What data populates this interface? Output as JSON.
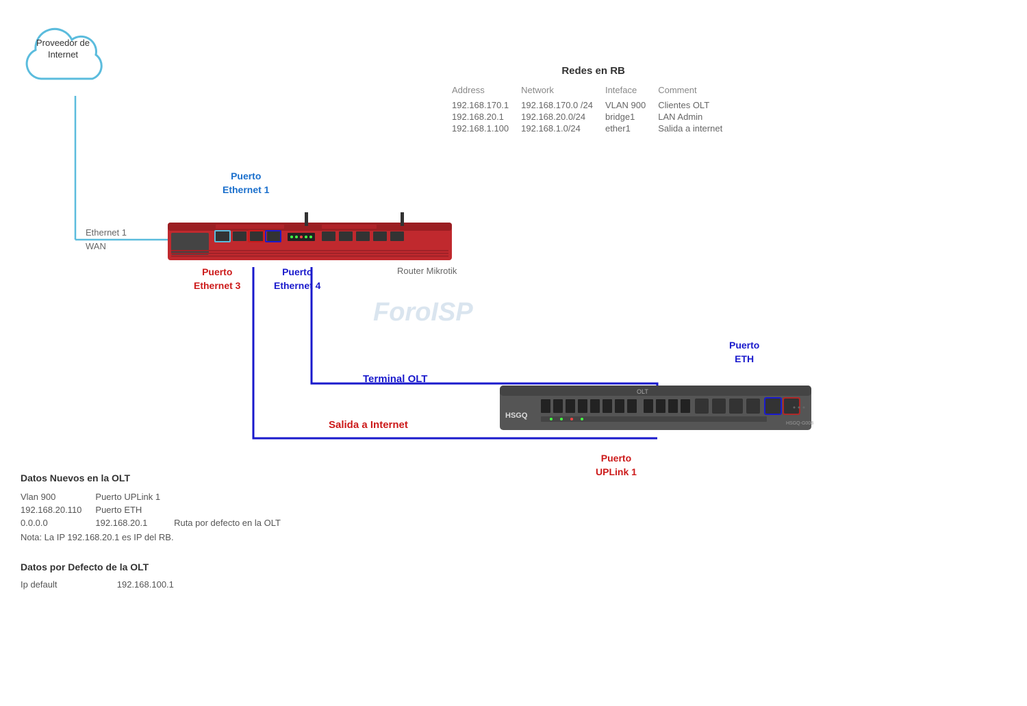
{
  "cloud": {
    "label_line1": "Proveedor de",
    "label_line2": "Internet"
  },
  "eth1_wan": {
    "line1": "Ethernet 1",
    "line2": "WAN"
  },
  "router_label": "Router Mikrotik",
  "watermark": "ForoISP",
  "puertos": {
    "eth1": {
      "line1": "Puerto",
      "line2": "Ethernet 1"
    },
    "eth3": {
      "line1": "Puerto",
      "line2": "Ethernet 3"
    },
    "eth4": {
      "line1": "Puerto",
      "line2": "Ethernet 4"
    },
    "eth_olt": {
      "line1": "Puerto",
      "line2": "ETH"
    },
    "uplink": {
      "line1": "Puerto",
      "line2": "UPLink 1"
    }
  },
  "labels": {
    "terminal_olt": "Terminal OLT",
    "salida_internet": "Salida a Internet"
  },
  "redes_rb": {
    "title": "Redes en RB",
    "columns": [
      "Address",
      "Network",
      "Inteface",
      "Comment"
    ],
    "rows": [
      [
        "192.168.170.1",
        "192.168.170.0 /24",
        "VLAN 900",
        "Clientes OLT"
      ],
      [
        "192.168.20.1",
        "192.168.20.0/24",
        "bridge1",
        "LAN Admin"
      ],
      [
        "192.168.1.100",
        "192.168.1.0/24",
        "ether1",
        "Salida a internet"
      ]
    ]
  },
  "datos_nuevos": {
    "title": "Datos Nuevos en  la OLT",
    "rows": [
      [
        "Vlan 900",
        "Puerto UPLink 1",
        ""
      ],
      [
        "192.168.20.110",
        "Puerto ETH",
        ""
      ],
      [
        "0.0.0.0",
        "192.168.20.1",
        "Ruta  por defecto en la OLT"
      ]
    ],
    "note": "Nota: La IP 192.168.20.1 es IP del RB."
  },
  "datos_defecto": {
    "title": "Datos por Defecto de la OLT",
    "ip_label": "Ip default",
    "ip_value": "192.168.100.1"
  }
}
